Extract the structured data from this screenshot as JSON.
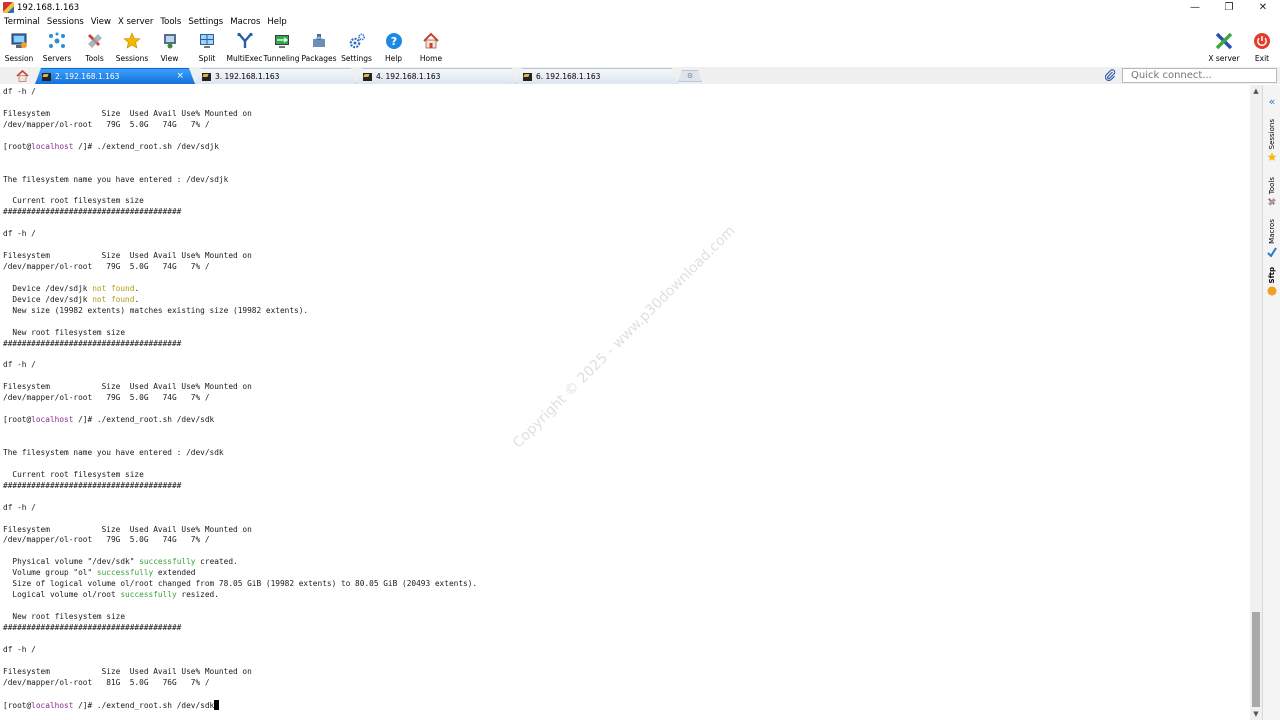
{
  "window": {
    "title": "192.168.1.163",
    "minimize": "—",
    "restore": "❐",
    "close": "✕"
  },
  "menu": [
    "Terminal",
    "Sessions",
    "View",
    "X server",
    "Tools",
    "Settings",
    "Macros",
    "Help"
  ],
  "toolbar": {
    "session": "Session",
    "servers": "Servers",
    "tools": "Tools",
    "sessions": "Sessions",
    "view": "View",
    "split": "Split",
    "multiexec": "MultiExec",
    "tunneling": "Tunneling",
    "packages": "Packages",
    "settings": "Settings",
    "help": "Help",
    "home": "Home",
    "xserver": "X server",
    "exit": "Exit"
  },
  "tabs": [
    {
      "label": "2. 192.168.1.163",
      "active": true
    },
    {
      "label": "3. 192.168.1.163",
      "active": false
    },
    {
      "label": "4. 192.168.1.163",
      "active": false
    },
    {
      "label": "6. 192.168.1.163",
      "active": false
    }
  ],
  "quick_connect": {
    "placeholder": "Quick connect..."
  },
  "sidebar": {
    "sessions": "Sessions",
    "tools": "Tools",
    "macros": "Macros",
    "sftp": "Sftp"
  },
  "watermark": "Copyright © 2025 - www.p30download.com",
  "terminal": {
    "lines": [
      [
        [
          "df ",
          ""
        ],
        [
          "-h",
          ""
        ],
        [
          " /",
          ""
        ]
      ],
      [],
      [
        [
          "Filesystem           Size  Used Avail Use% Mounted on",
          ""
        ]
      ],
      [
        [
          "/dev/mapper/ol-root   79G  5.0G   74G   7% /",
          ""
        ]
      ],
      [],
      [
        [
          "[root@",
          ""
        ],
        [
          "localhost",
          "host"
        ],
        [
          " /]# ./extend_root.sh /dev/sdjk",
          ""
        ]
      ],
      [],
      [],
      [
        [
          "The filesystem name you have entered : /dev/sdjk",
          ""
        ]
      ],
      [],
      [
        [
          "  Current root filesystem size",
          ""
        ]
      ],
      [
        [
          "######################################",
          ""
        ]
      ],
      [],
      [
        [
          "df ",
          ""
        ],
        [
          "-h",
          ""
        ],
        [
          " /",
          ""
        ]
      ],
      [],
      [
        [
          "Filesystem           Size  Used Avail Use% Mounted on",
          ""
        ]
      ],
      [
        [
          "/dev/mapper/ol-root   79G  5.0G   74G   7% /",
          ""
        ]
      ],
      [],
      [
        [
          "  Device /dev/sdjk ",
          ""
        ],
        [
          "not found",
          "warn"
        ],
        [
          ".",
          ""
        ]
      ],
      [
        [
          "  Device /dev/sdjk ",
          ""
        ],
        [
          "not found",
          "warn"
        ],
        [
          ".",
          ""
        ]
      ],
      [
        [
          "  New size (19982 extents) matches existing size (19982 extents).",
          ""
        ]
      ],
      [],
      [
        [
          "  New root filesystem size",
          ""
        ]
      ],
      [
        [
          "######################################",
          ""
        ]
      ],
      [],
      [
        [
          "df ",
          ""
        ],
        [
          "-h",
          ""
        ],
        [
          " /",
          ""
        ]
      ],
      [],
      [
        [
          "Filesystem           Size  Used Avail Use% Mounted on",
          ""
        ]
      ],
      [
        [
          "/dev/mapper/ol-root   79G  5.0G   74G   7% /",
          ""
        ]
      ],
      [],
      [
        [
          "[root@",
          ""
        ],
        [
          "localhost",
          "host"
        ],
        [
          " /]# ./extend_root.sh /dev/sdk",
          ""
        ]
      ],
      [],
      [],
      [
        [
          "The filesystem name you have entered : /dev/sdk",
          ""
        ]
      ],
      [],
      [
        [
          "  Current root filesystem size",
          ""
        ]
      ],
      [
        [
          "######################################",
          ""
        ]
      ],
      [],
      [
        [
          "df ",
          ""
        ],
        [
          "-h",
          ""
        ],
        [
          " /",
          ""
        ]
      ],
      [],
      [
        [
          "Filesystem           Size  Used Avail Use% Mounted on",
          ""
        ]
      ],
      [
        [
          "/dev/mapper/ol-root   79G  5.0G   74G   7% /",
          ""
        ]
      ],
      [],
      [
        [
          "  Physical volume \"/dev/sdk\" ",
          ""
        ],
        [
          "successfully",
          "ok"
        ],
        [
          " created.",
          ""
        ]
      ],
      [
        [
          "  Volume group \"ol\" ",
          ""
        ],
        [
          "successfully",
          "ok"
        ],
        [
          " extended",
          ""
        ]
      ],
      [
        [
          "  Size of logical volume ol/root changed from 78.05 GiB (19982 extents) to 80.05 GiB (20493 extents).",
          ""
        ]
      ],
      [
        [
          "  Logical volume ol/root ",
          ""
        ],
        [
          "successfully",
          "ok"
        ],
        [
          " resized.",
          ""
        ]
      ],
      [],
      [
        [
          "  New root filesystem size",
          ""
        ]
      ],
      [
        [
          "######################################",
          ""
        ]
      ],
      [],
      [
        [
          "df ",
          ""
        ],
        [
          "-h",
          ""
        ],
        [
          " /",
          ""
        ]
      ],
      [],
      [
        [
          "Filesystem           Size  Used Avail Use% Mounted on",
          ""
        ]
      ],
      [
        [
          "/dev/mapper/ol-root   81G  5.0G   76G   7% /",
          ""
        ]
      ],
      [],
      [
        [
          "[root@",
          ""
        ],
        [
          "localhost",
          "host"
        ],
        [
          " /]# ./extend_root.sh /dev/sdk",
          ""
        ]
      ]
    ]
  }
}
